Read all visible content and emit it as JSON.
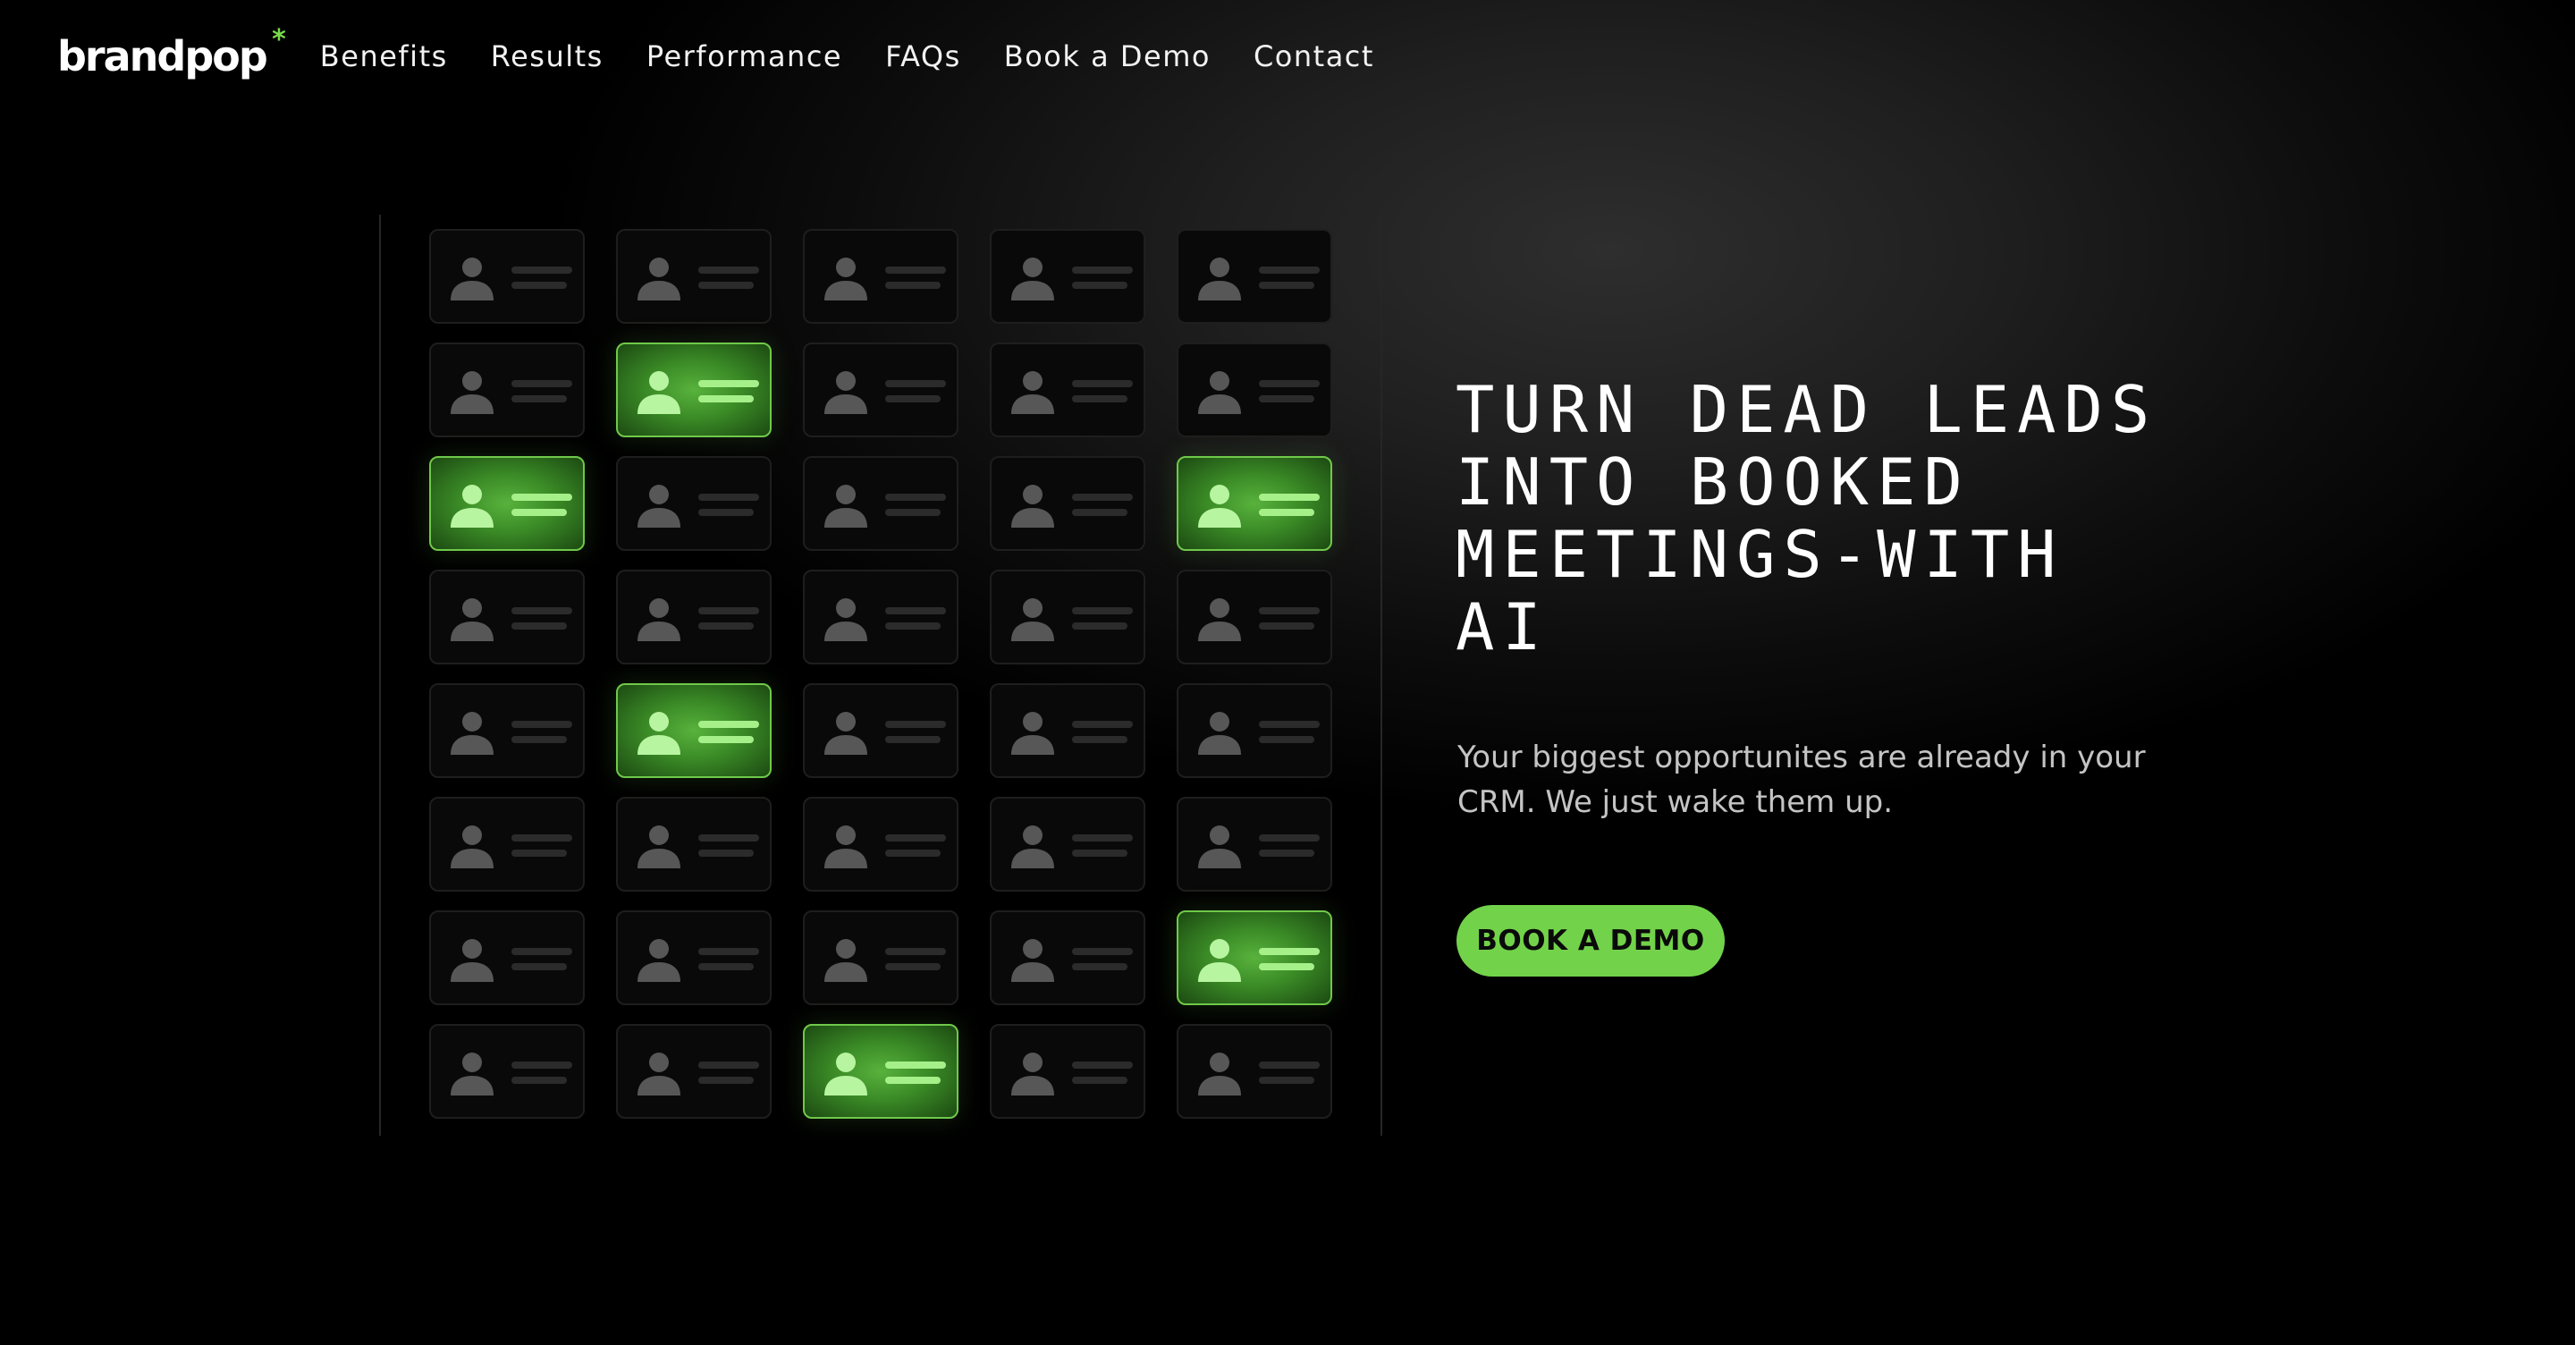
{
  "header": {
    "logo_text": "brandpop",
    "logo_mark": "*",
    "nav": [
      {
        "label": "Benefits"
      },
      {
        "label": "Results"
      },
      {
        "label": "Performance"
      },
      {
        "label": "FAQs"
      },
      {
        "label": "Book a Demo"
      },
      {
        "label": "Contact"
      }
    ]
  },
  "hero": {
    "title_lines": [
      "TURN DEAD LEADS",
      "INTO BOOKED",
      "MEETINGS-WITH",
      "AI"
    ],
    "subtitle": "Your biggest opportunites are already in your CRM. We just wake them up.",
    "cta_label": "BOOK A DEMO"
  },
  "lead_grid": {
    "columns": 5,
    "rows": 8,
    "card_icon": "person-icon",
    "active_cells": [
      {
        "row": 2,
        "col": 2
      },
      {
        "row": 3,
        "col": 1
      },
      {
        "row": 3,
        "col": 5
      },
      {
        "row": 5,
        "col": 2
      },
      {
        "row": 7,
        "col": 5
      },
      {
        "row": 8,
        "col": 3
      }
    ]
  },
  "colors": {
    "accent": "#72d34a",
    "background": "#000000",
    "card_inactive": "#090909",
    "card_active": "#3a8a26"
  }
}
